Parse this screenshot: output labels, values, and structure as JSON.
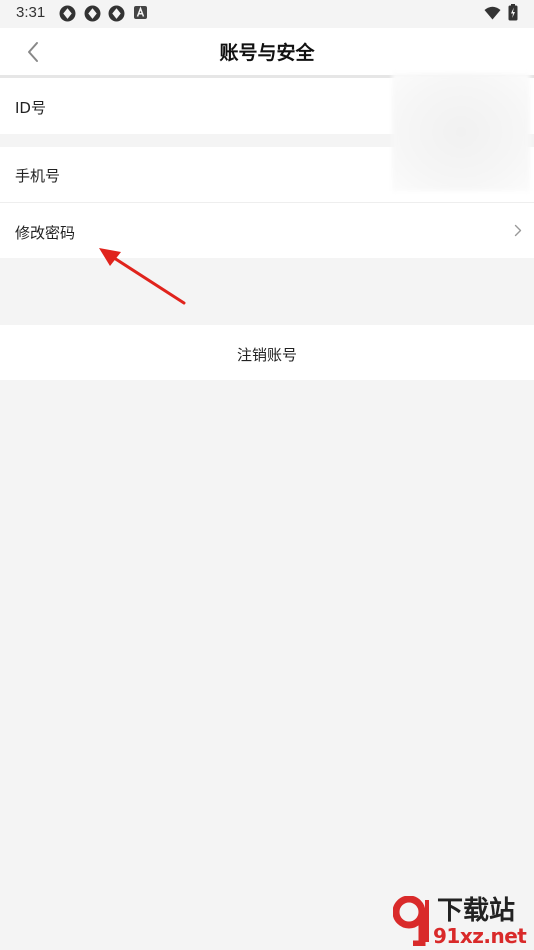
{
  "status_bar": {
    "time": "3:31",
    "left_icons": [
      "aperture-icon",
      "aperture-icon",
      "aperture-icon",
      "a-badge-icon"
    ],
    "right_icons": [
      "wifi-icon",
      "battery-icon"
    ]
  },
  "header": {
    "title": "账号与安全",
    "back_icon": "chevron-left-icon"
  },
  "settings": {
    "id_label": "ID号",
    "phone_label": "手机号",
    "change_password_label": "修改密码",
    "chevron_icon": "chevron-right-icon"
  },
  "logout": {
    "label": "注销账号"
  },
  "annotation": {
    "arrow_color": "#e0231c"
  },
  "watermark": {
    "top_text": "下载站",
    "bottom_text": "91xz.net",
    "logo_color": "#d92a2a"
  },
  "colors": {
    "background": "#f4f4f4",
    "card": "#ffffff"
  }
}
